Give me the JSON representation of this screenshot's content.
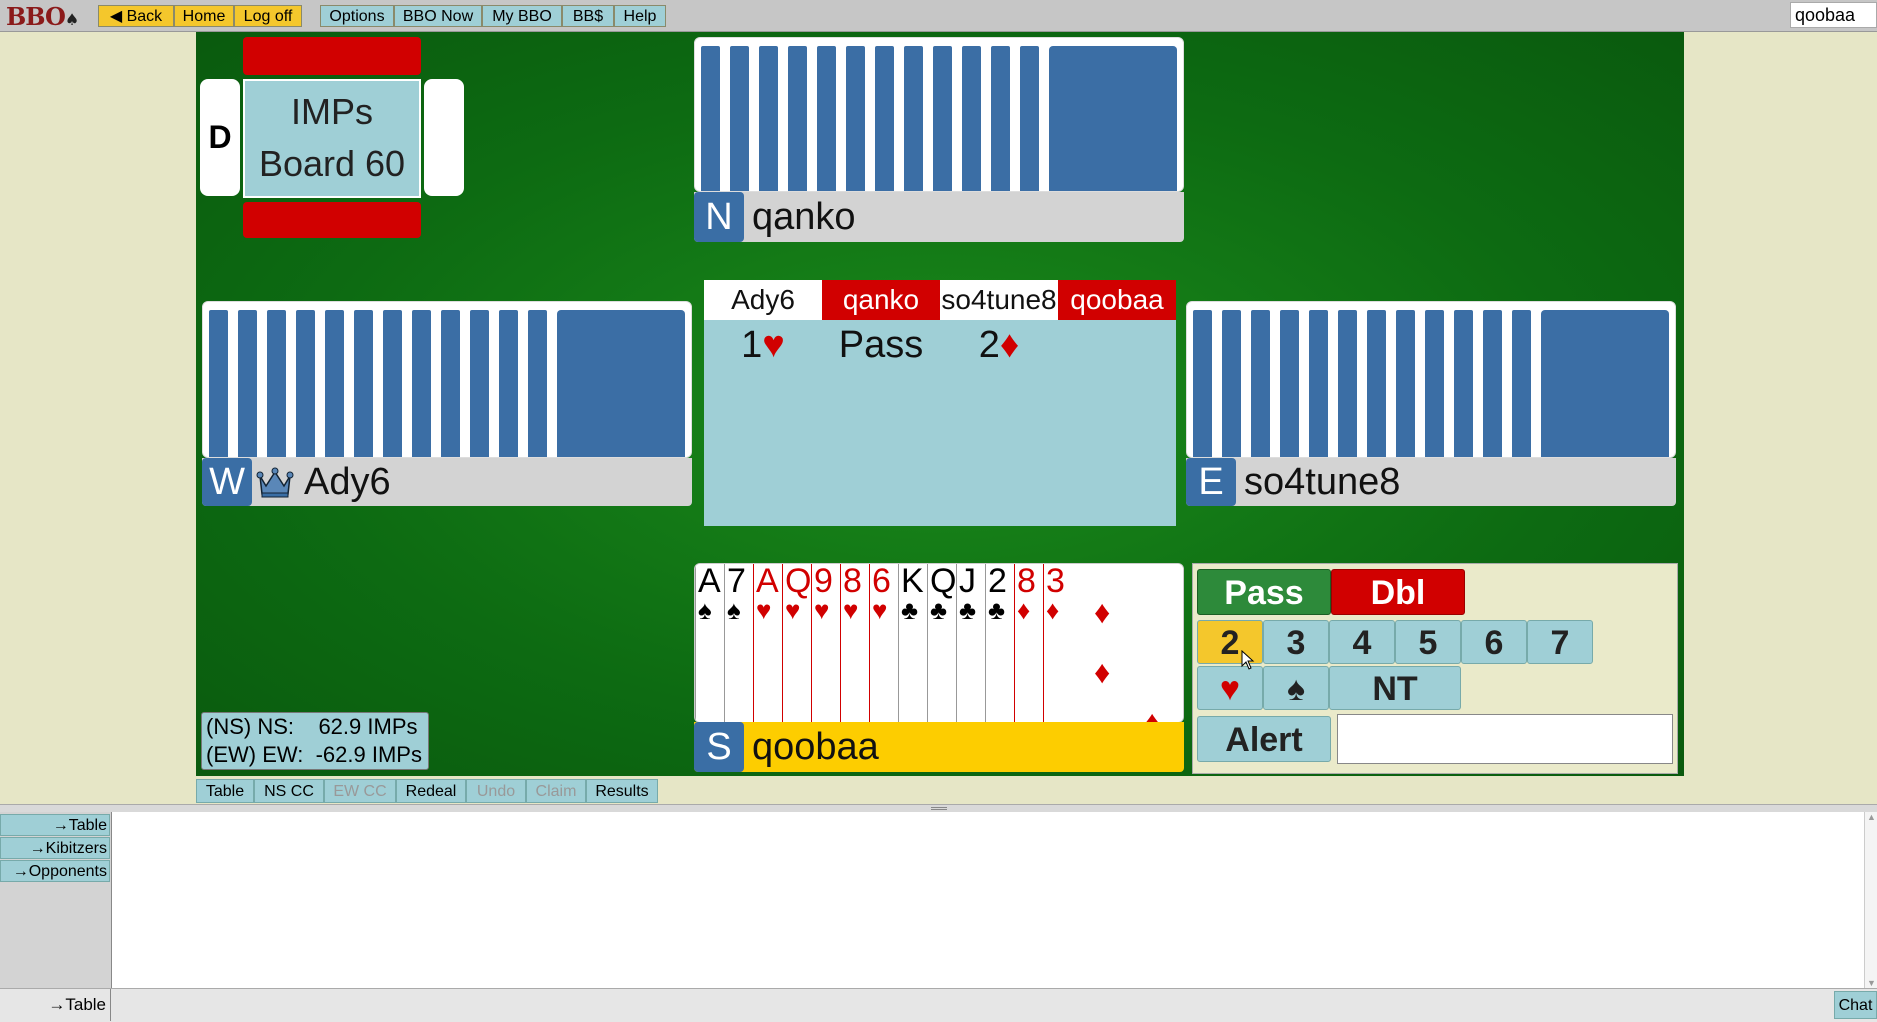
{
  "topbar": {
    "logo": "BBO",
    "back": "◀ Back",
    "home": "Home",
    "logoff": "Log off",
    "options": "Options",
    "bbo_now": "BBO Now",
    "my_bbo": "My BBO",
    "bbdollar": "BB$",
    "help": "Help",
    "username": "qoobaa"
  },
  "board": {
    "dealer": "D",
    "scoring": "IMPs",
    "number": "Board 60"
  },
  "players": {
    "north": {
      "seat": "N",
      "name": "qanko"
    },
    "west": {
      "seat": "W",
      "name": "Ady6"
    },
    "east": {
      "seat": "E",
      "name": "so4tune8"
    },
    "south": {
      "seat": "S",
      "name": "qoobaa"
    }
  },
  "auction": {
    "headers": [
      "Ady6",
      "qanko",
      "so4tune8",
      "qoobaa"
    ],
    "bids": [
      {
        "level": "1",
        "suit": "♥"
      },
      {
        "level": "Pass",
        "suit": ""
      },
      {
        "level": "2",
        "suit": "♦"
      }
    ]
  },
  "south_hand": [
    {
      "rank": "A",
      "suit": "♠",
      "color": "black"
    },
    {
      "rank": "7",
      "suit": "♠",
      "color": "black"
    },
    {
      "rank": "A",
      "suit": "♥",
      "color": "red"
    },
    {
      "rank": "Q",
      "suit": "♥",
      "color": "red"
    },
    {
      "rank": "9",
      "suit": "♥",
      "color": "red"
    },
    {
      "rank": "8",
      "suit": "♥",
      "color": "red"
    },
    {
      "rank": "6",
      "suit": "♥",
      "color": "red"
    },
    {
      "rank": "K",
      "suit": "♣",
      "color": "black"
    },
    {
      "rank": "Q",
      "suit": "♣",
      "color": "black"
    },
    {
      "rank": "J",
      "suit": "♣",
      "color": "black"
    },
    {
      "rank": "2",
      "suit": "♣",
      "color": "black"
    },
    {
      "rank": "8",
      "suit": "♦",
      "color": "red"
    },
    {
      "rank": "3",
      "suit": "♦",
      "color": "red"
    }
  ],
  "bidding_box": {
    "pass": "Pass",
    "dbl": "Dbl",
    "levels": [
      "2",
      "3",
      "4",
      "5",
      "6",
      "7"
    ],
    "selected_level": "2",
    "heart": "♥",
    "spade": "♠",
    "nt": "NT",
    "alert": "Alert",
    "alert_text": ""
  },
  "score": {
    "ns": "(NS) NS:    62.9 IMPs",
    "ew": "(EW) EW:  -62.9 IMPs"
  },
  "bottom_tabs": [
    "Table",
    "NS CC",
    "EW CC",
    "Redeal",
    "Undo",
    "Claim",
    "Results"
  ],
  "chat": {
    "targets": [
      "→Table",
      "→Kibitzers",
      "→Opponents"
    ],
    "current_target": "→Table",
    "chat_button": "Chat"
  },
  "colors": {
    "felt": "#0d6b12",
    "card_back": "#3b6ea5",
    "accent_red": "#d10000",
    "accent_yellow": "#f4c72c",
    "panel_blue": "#9fcfd6"
  }
}
